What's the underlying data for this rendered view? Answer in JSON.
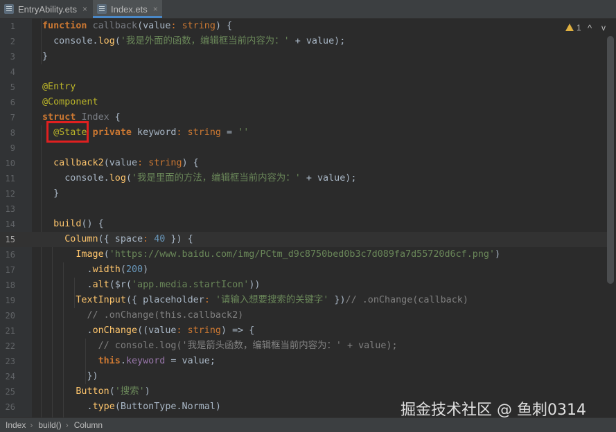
{
  "tabs": [
    {
      "label": "EntryAbility.ets",
      "close": "×",
      "active": false
    },
    {
      "label": "Index.ets",
      "close": "×",
      "active": true
    }
  ],
  "inspection": {
    "count": "1",
    "up": "^",
    "down": "v"
  },
  "current_line": 15,
  "lines": [
    {
      "n": "1",
      "segs": [
        [
          "kw",
          "function"
        ],
        [
          "p",
          " "
        ],
        [
          "gray",
          "callback"
        ],
        [
          "p",
          "("
        ],
        [
          "p",
          "value"
        ],
        [
          "kwn",
          ": "
        ],
        [
          "kwn",
          "string"
        ],
        [
          "p",
          ") {"
        ]
      ]
    },
    {
      "n": "2",
      "segs": [
        [
          "p",
          "  console."
        ],
        [
          "fn",
          "log"
        ],
        [
          "p",
          "("
        ],
        [
          "str",
          "'我是外面的函数，编辑框当前内容为：'"
        ],
        [
          "p",
          " + value);"
        ]
      ]
    },
    {
      "n": "3",
      "segs": [
        [
          "p",
          "}"
        ]
      ]
    },
    {
      "n": "4",
      "segs": []
    },
    {
      "n": "5",
      "segs": [
        [
          "ann",
          "@Entry"
        ]
      ]
    },
    {
      "n": "6",
      "segs": [
        [
          "ann",
          "@Component"
        ]
      ]
    },
    {
      "n": "7",
      "segs": [
        [
          "kw",
          "struct"
        ],
        [
          "p",
          " "
        ],
        [
          "gray",
          "Index"
        ],
        [
          "p",
          " {"
        ]
      ]
    },
    {
      "n": "8",
      "segs": [
        [
          "p",
          "  "
        ],
        [
          "ann",
          "@State"
        ],
        [
          "p",
          " "
        ],
        [
          "kw",
          "private"
        ],
        [
          "p",
          " keyword"
        ],
        [
          "kwn",
          ": "
        ],
        [
          "kwn",
          "string"
        ],
        [
          "p",
          " = "
        ],
        [
          "str",
          "''"
        ]
      ]
    },
    {
      "n": "9",
      "segs": []
    },
    {
      "n": "10",
      "segs": [
        [
          "p",
          "  "
        ],
        [
          "fn",
          "callback2"
        ],
        [
          "p",
          "(value"
        ],
        [
          "kwn",
          ": "
        ],
        [
          "kwn",
          "string"
        ],
        [
          "p",
          ") {"
        ]
      ]
    },
    {
      "n": "11",
      "segs": [
        [
          "p",
          "    console."
        ],
        [
          "fn",
          "log"
        ],
        [
          "p",
          "("
        ],
        [
          "str",
          "'我是里面的方法，编辑框当前内容为：'"
        ],
        [
          "p",
          " + value);"
        ]
      ]
    },
    {
      "n": "12",
      "segs": [
        [
          "p",
          "  }"
        ]
      ]
    },
    {
      "n": "13",
      "segs": []
    },
    {
      "n": "14",
      "segs": [
        [
          "p",
          "  "
        ],
        [
          "fn",
          "build"
        ],
        [
          "p",
          "() {"
        ]
      ]
    },
    {
      "n": "15",
      "segs": [
        [
          "p",
          "    "
        ],
        [
          "fn",
          "Column"
        ],
        [
          "p",
          "({ space"
        ],
        [
          "kwn",
          ": "
        ],
        [
          "num",
          "40"
        ],
        [
          "p",
          " }) {"
        ]
      ]
    },
    {
      "n": "16",
      "segs": [
        [
          "p",
          "      "
        ],
        [
          "fn",
          "Image"
        ],
        [
          "p",
          "("
        ],
        [
          "str",
          "'https://www.baidu.com/img/PCtm_d9c8750bed0b3c7d089fa7d55720d6cf.png'"
        ],
        [
          "p",
          ")"
        ]
      ]
    },
    {
      "n": "17",
      "segs": [
        [
          "p",
          "        ."
        ],
        [
          "fn",
          "width"
        ],
        [
          "p",
          "("
        ],
        [
          "num",
          "200"
        ],
        [
          "p",
          ")"
        ]
      ]
    },
    {
      "n": "18",
      "segs": [
        [
          "p",
          "        ."
        ],
        [
          "fn",
          "alt"
        ],
        [
          "p",
          "($r("
        ],
        [
          "str",
          "'app.media.startIcon'"
        ],
        [
          "p",
          "))"
        ]
      ]
    },
    {
      "n": "19",
      "segs": [
        [
          "p",
          "      "
        ],
        [
          "fn",
          "TextInput"
        ],
        [
          "p",
          "({ placeholder"
        ],
        [
          "kwn",
          ": "
        ],
        [
          "str",
          "'请输入想要搜索的关键字'"
        ],
        [
          "p",
          " })"
        ],
        [
          "com",
          "// .onChange(callback)"
        ]
      ]
    },
    {
      "n": "20",
      "segs": [
        [
          "com",
          "        // .onChange(this.callback2)"
        ]
      ]
    },
    {
      "n": "21",
      "segs": [
        [
          "p",
          "        ."
        ],
        [
          "fn",
          "onChange"
        ],
        [
          "p",
          "((value"
        ],
        [
          "kwn",
          ": "
        ],
        [
          "kwn",
          "string"
        ],
        [
          "p",
          ") => {"
        ]
      ]
    },
    {
      "n": "22",
      "segs": [
        [
          "com",
          "          // console.log('我是箭头函数，编辑框当前内容为：' + value);"
        ]
      ]
    },
    {
      "n": "23",
      "segs": [
        [
          "p",
          "          "
        ],
        [
          "kw",
          "this"
        ],
        [
          "p",
          "."
        ],
        [
          "field",
          "keyword"
        ],
        [
          "p",
          " = value;"
        ]
      ]
    },
    {
      "n": "24",
      "segs": [
        [
          "p",
          "        })"
        ]
      ]
    },
    {
      "n": "25",
      "segs": [
        [
          "p",
          "      "
        ],
        [
          "fn",
          "Button"
        ],
        [
          "p",
          "("
        ],
        [
          "str",
          "'搜索'"
        ],
        [
          "p",
          ")"
        ]
      ]
    },
    {
      "n": "26",
      "segs": [
        [
          "p",
          "        ."
        ],
        [
          "fn",
          "type"
        ],
        [
          "p",
          "(ButtonType.Normal)"
        ]
      ]
    }
  ],
  "breadcrumb": [
    "Index",
    "build()",
    "Column"
  ],
  "watermark": "掘金技术社区 @ 鱼刺0314"
}
